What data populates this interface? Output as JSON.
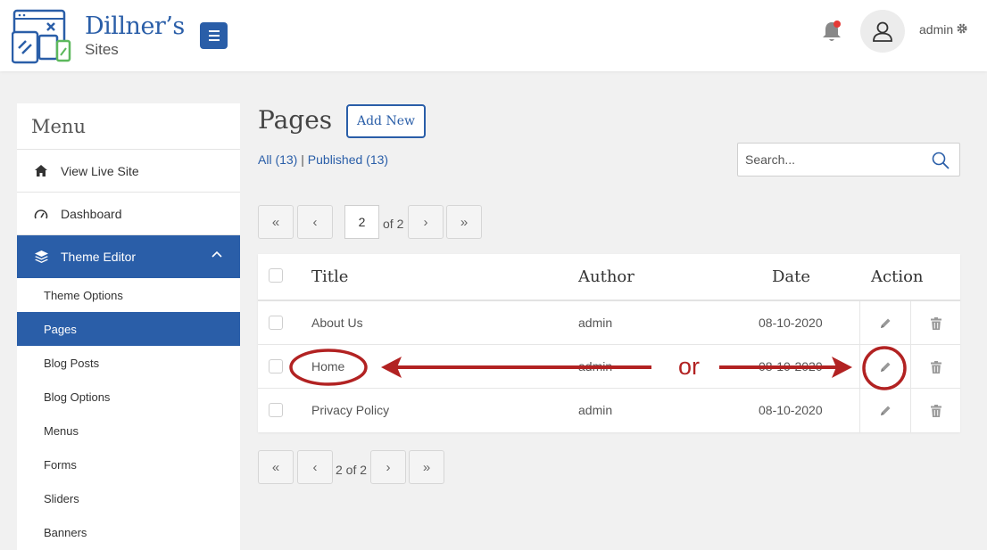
{
  "header": {
    "brand": "Dillner’s",
    "brand_sub": "Sites",
    "user": "admin",
    "colors": {
      "accent": "#2a5ea8",
      "notification": "#e53935"
    }
  },
  "sidebar": {
    "title": "Menu",
    "items": [
      {
        "label": "View Live Site",
        "icon": "home-icon"
      },
      {
        "label": "Dashboard",
        "icon": "gauge-icon"
      },
      {
        "label": "Theme Editor",
        "icon": "layers-icon",
        "active": true
      }
    ],
    "sub_items": [
      {
        "label": "Theme Options"
      },
      {
        "label": "Pages",
        "current": true
      },
      {
        "label": "Blog Posts"
      },
      {
        "label": "Blog Options"
      },
      {
        "label": "Menus"
      },
      {
        "label": "Forms"
      },
      {
        "label": "Sliders"
      },
      {
        "label": "Banners"
      }
    ]
  },
  "main": {
    "title": "Pages",
    "add_new": "Add New",
    "filter_all": "All (13)",
    "filter_sep": "|",
    "filter_published": "Published (13)",
    "search_placeholder": "Search...",
    "pagination_top": {
      "first": "«",
      "prev": "‹",
      "page": "2",
      "of": "of 2",
      "next": "›",
      "last": "»"
    },
    "pagination_bottom": {
      "first": "«",
      "prev": "‹",
      "label": "2 of 2",
      "next": "›",
      "last": "»"
    },
    "table": {
      "headers": {
        "title": "Title",
        "author": "Author",
        "date": "Date",
        "action": "Action"
      },
      "rows": [
        {
          "title": "About Us",
          "author": "admin",
          "date": "08-10-2020"
        },
        {
          "title": "Home",
          "author": "admin",
          "date": "08-10-2020"
        },
        {
          "title": "Privacy Policy",
          "author": "admin",
          "date": "08-10-2020"
        }
      ]
    }
  },
  "annotation": {
    "or_text": "or",
    "color": "#b22222"
  }
}
